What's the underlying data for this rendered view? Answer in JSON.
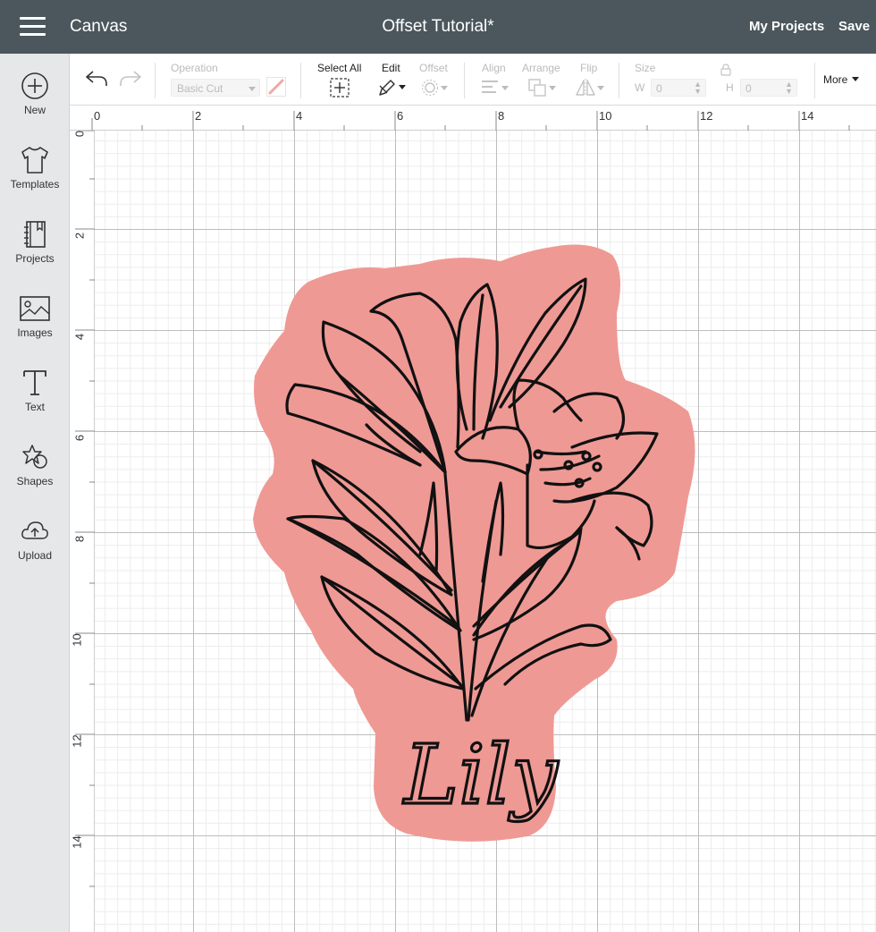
{
  "header": {
    "app_title": "Canvas",
    "doc_title": "Offset Tutorial*",
    "my_projects": "My Projects",
    "save": "Save"
  },
  "sidebar": {
    "items": [
      {
        "label": "New",
        "icon": "plus-circle-icon"
      },
      {
        "label": "Templates",
        "icon": "tshirt-icon"
      },
      {
        "label": "Projects",
        "icon": "notebook-icon"
      },
      {
        "label": "Images",
        "icon": "image-icon"
      },
      {
        "label": "Text",
        "icon": "text-icon"
      },
      {
        "label": "Shapes",
        "icon": "shapes-icon"
      },
      {
        "label": "Upload",
        "icon": "cloud-upload-icon"
      }
    ]
  },
  "toolbar": {
    "operation_label": "Operation",
    "operation_value": "Basic Cut",
    "select_all": "Select All",
    "edit": "Edit",
    "offset": "Offset",
    "align": "Align",
    "arrange": "Arrange",
    "flip": "Flip",
    "size": "Size",
    "w_label": "W",
    "w_value": "0",
    "h_label": "H",
    "h_value": "0",
    "more": "More"
  },
  "ruler": {
    "top": [
      "0",
      "2",
      "4",
      "6",
      "8",
      "10",
      "12",
      "14"
    ],
    "left": [
      "0",
      "2",
      "4",
      "6",
      "8",
      "10",
      "12",
      "14"
    ]
  },
  "design": {
    "text": "Lily",
    "offset_color": "#ef9994",
    "line_color": "#111111"
  },
  "colors": {
    "topbar": "#4b575c",
    "sidebar": "#e6e7e8"
  }
}
